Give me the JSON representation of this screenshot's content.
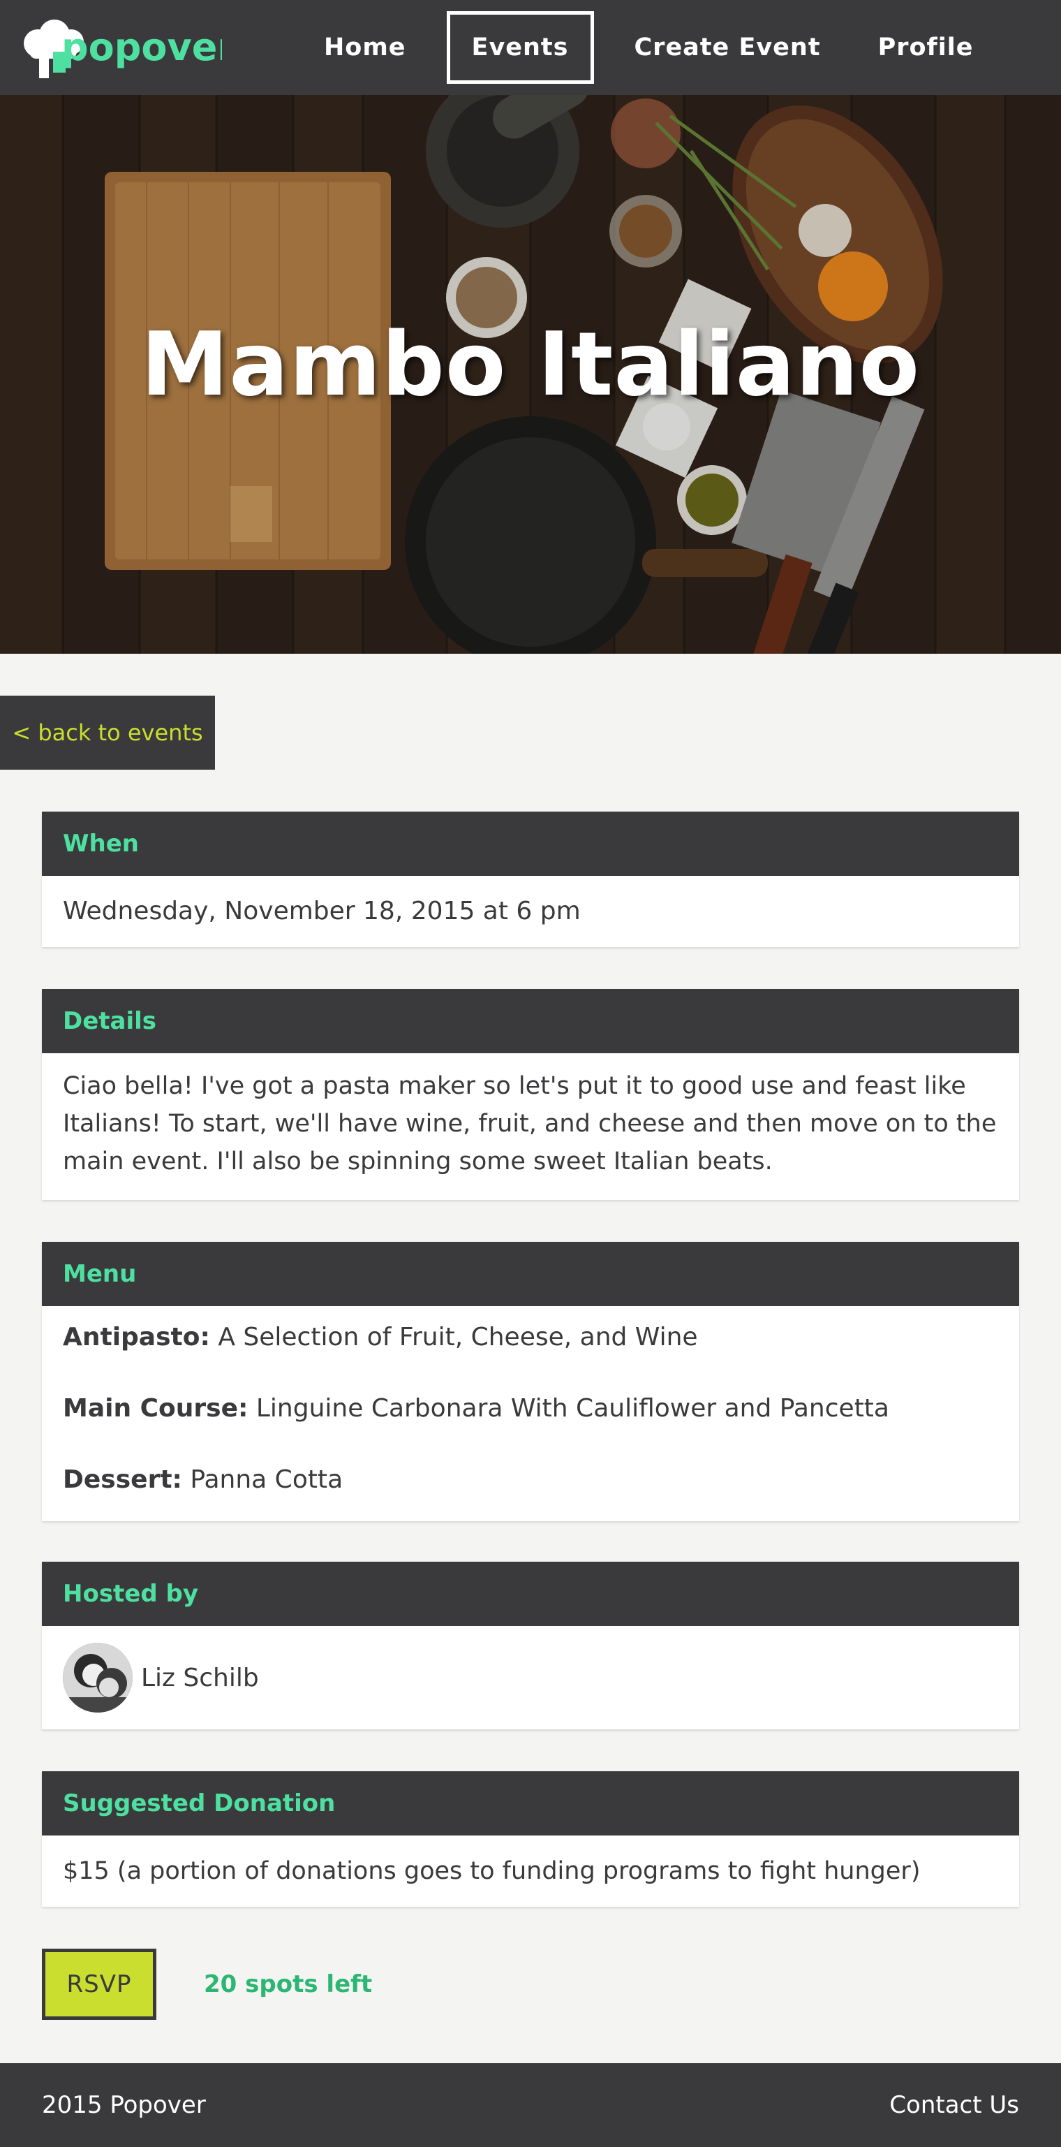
{
  "colors": {
    "dark": "#3a3a3c",
    "accent_green": "#4ee0a0",
    "lime": "#c9de2e",
    "spots_green": "#2cb673",
    "page_bg": "#f4f4f2"
  },
  "nav": {
    "logo_text": "popover",
    "links": [
      "Home",
      "Events",
      "Create Event",
      "Profile"
    ],
    "active": "Events"
  },
  "hero": {
    "title": "Mambo Italiano"
  },
  "back": {
    "label": "< back to events"
  },
  "when": {
    "heading": "When",
    "text": "Wednesday, November 18, 2015 at 6 pm"
  },
  "details": {
    "heading": "Details",
    "text": "Ciao bella! I've got a pasta maker so let's put it to good use and feast like Italians! To start, we'll have wine, fruit, and cheese and then move on to the main event. I'll also be spinning some sweet Italian beats."
  },
  "menu": {
    "heading": "Menu",
    "items": [
      {
        "course": "Antipasto:",
        "dish": "A Selection of Fruit, Cheese, and Wine"
      },
      {
        "course": "Main Course:",
        "dish": "Linguine Carbonara With Cauliflower and Pancetta"
      },
      {
        "course": "Dessert:",
        "dish": "Panna Cotta"
      }
    ]
  },
  "host": {
    "heading": "Hosted by",
    "name": "Liz Schilb"
  },
  "donation": {
    "heading": "Suggested Donation",
    "text": "$15 (a portion of donations goes to funding programs to fight hunger)"
  },
  "rsvp": {
    "button_label": "RSVP",
    "spots_left": "20 spots left"
  },
  "footer": {
    "copyright": "2015 Popover",
    "contact": "Contact Us"
  }
}
